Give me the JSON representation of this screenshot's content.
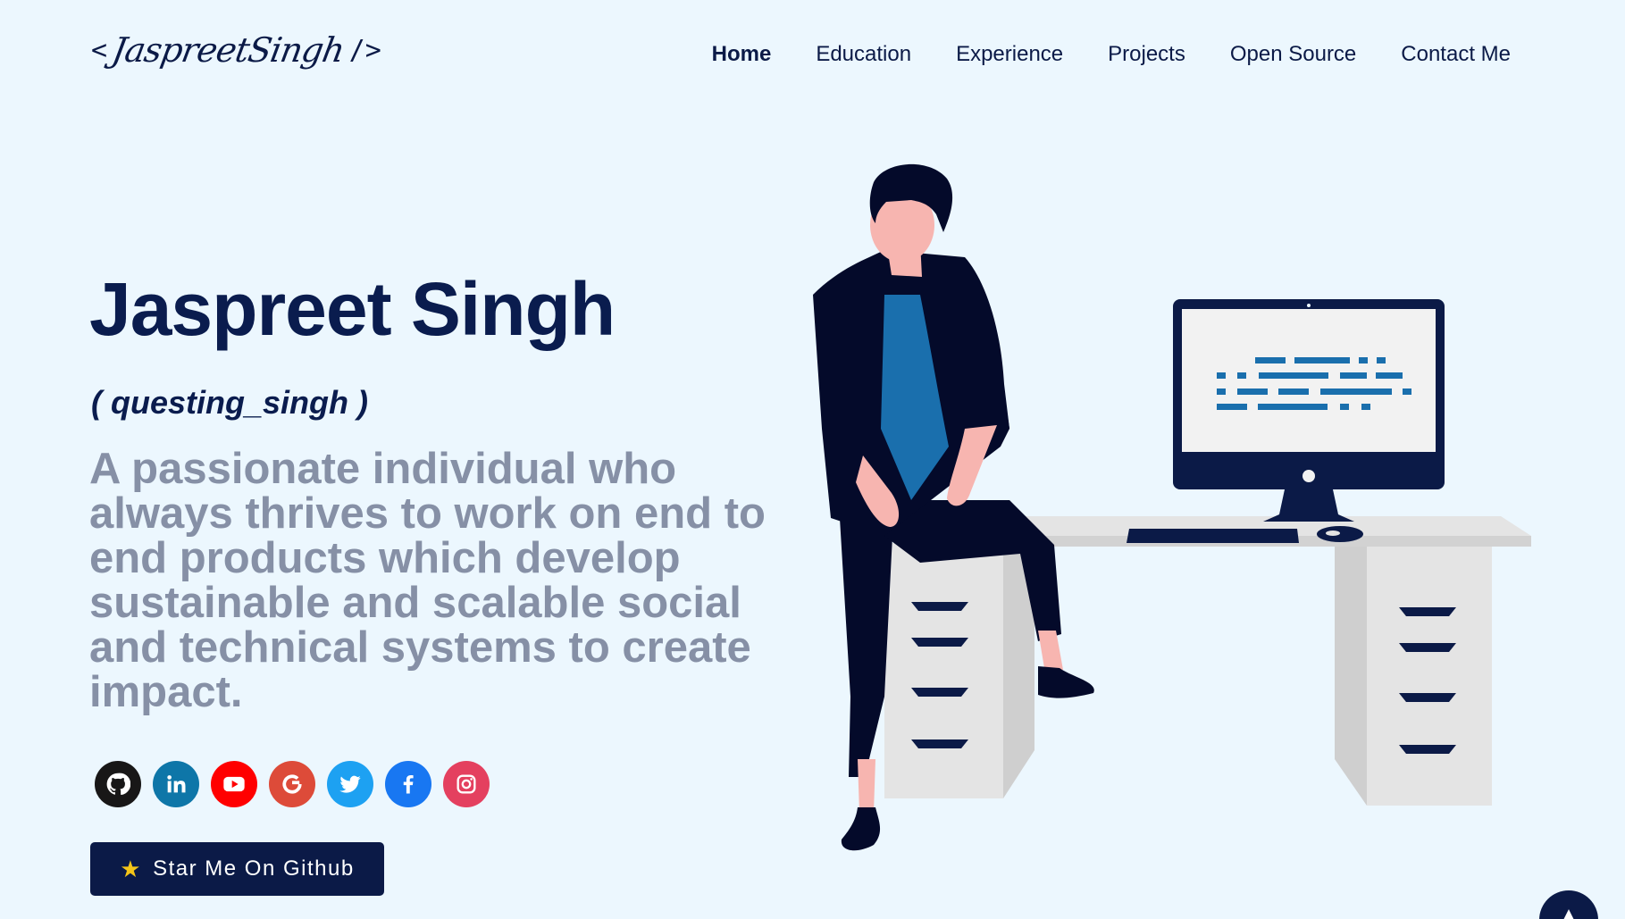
{
  "header": {
    "logo": {
      "open": "<",
      "signature": "JaspreetSingh",
      "close": "/>"
    },
    "nav": [
      {
        "label": "Home",
        "active": true
      },
      {
        "label": "Education"
      },
      {
        "label": "Experience"
      },
      {
        "label": "Projects"
      },
      {
        "label": "Open Source"
      },
      {
        "label": "Contact Me"
      }
    ]
  },
  "hero": {
    "name": "Jaspreet Singh",
    "handle": "( questing_singh )",
    "description": "A passionate individual who always thrives to work on end to end products which develop sustainable and scalable social and technical systems to create impact."
  },
  "socials": [
    {
      "name": "github",
      "icon": "github-icon",
      "color": "#181717"
    },
    {
      "name": "linkedin",
      "icon": "linkedin-icon",
      "color": "#0e76a8"
    },
    {
      "name": "youtube",
      "icon": "youtube-icon",
      "color": "#ff0000"
    },
    {
      "name": "google",
      "icon": "google-icon",
      "color": "#dd4b39"
    },
    {
      "name": "twitter",
      "icon": "twitter-icon",
      "color": "#1da1f2"
    },
    {
      "name": "facebook",
      "icon": "facebook-icon",
      "color": "#1877f2"
    },
    {
      "name": "instagram",
      "icon": "instagram-icon",
      "color": "#e4405f"
    }
  ],
  "star_button": {
    "icon": "star-icon",
    "label": "Star Me On Github"
  },
  "scroll_top": {
    "icon": "chevron-up-icon"
  },
  "colors": {
    "background": "#ecf7fe",
    "primary": "#0b1a47",
    "muted_text": "#8690a6",
    "accent_blue": "#1a6fad"
  }
}
